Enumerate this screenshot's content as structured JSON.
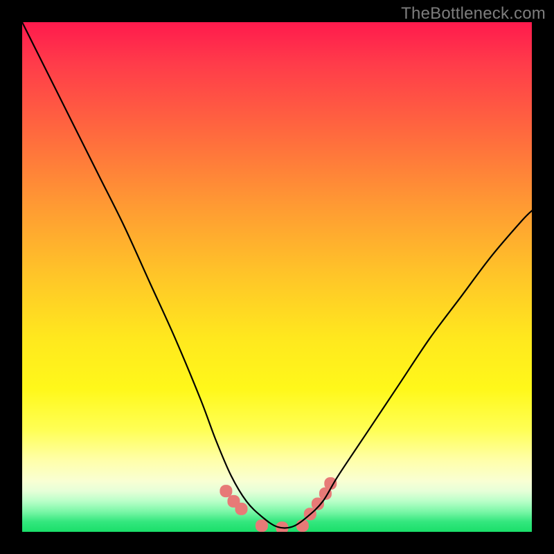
{
  "watermark": "TheBottleneck.com",
  "chart_data": {
    "type": "line",
    "title": "",
    "xlabel": "",
    "ylabel": "",
    "xlim": [
      0,
      100
    ],
    "ylim": [
      0,
      100
    ],
    "grid": false,
    "background_gradient": {
      "direction": "vertical",
      "stops": [
        {
          "pos": 0.0,
          "color": "#ff1a4d"
        },
        {
          "pos": 0.5,
          "color": "#ffc628"
        },
        {
          "pos": 0.8,
          "color": "#ffff55"
        },
        {
          "pos": 0.92,
          "color": "#e6ffd8"
        },
        {
          "pos": 1.0,
          "color": "#1adf6a"
        }
      ]
    },
    "series": [
      {
        "name": "bottleneck-curve",
        "x": [
          0,
          5,
          10,
          15,
          20,
          25,
          30,
          35,
          38,
          41,
          44,
          47,
          50,
          53,
          56,
          59,
          62,
          68,
          74,
          80,
          86,
          92,
          98,
          100
        ],
        "y": [
          100,
          90,
          80,
          70,
          60,
          49,
          38,
          26,
          18,
          11,
          6,
          3,
          1,
          1,
          3,
          6,
          11,
          20,
          29,
          38,
          46,
          54,
          61,
          63
        ],
        "stroke": "#000000",
        "stroke_width": 2
      },
      {
        "name": "min-markers",
        "type": "scatter",
        "x": [
          40,
          41.5,
          43,
          47,
          51,
          55,
          56.5,
          58,
          59.5,
          60.5
        ],
        "y": [
          8,
          6,
          4.5,
          1.2,
          0.8,
          1.2,
          3.5,
          5.5,
          7.5,
          9.5
        ],
        "marker": "rounded-rect",
        "color": "#e77a77",
        "size": 18
      }
    ],
    "annotations": [
      {
        "type": "watermark",
        "text": "TheBottleneck.com",
        "position": "top-right",
        "color": "#7d7d7d"
      }
    ]
  }
}
